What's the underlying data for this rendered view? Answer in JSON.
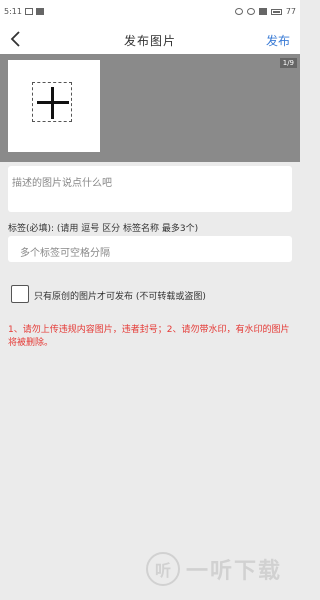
{
  "status_bar": {
    "time": "5:11",
    "battery": "77"
  },
  "navbar": {
    "title": "发布图片",
    "publish_label": "发布"
  },
  "photos": {
    "counter": "1/9"
  },
  "description": {
    "placeholder": "描述的图片说点什么吧"
  },
  "tags": {
    "label": "标签(必填): (请用 逗号 区分 标签名称 最多3个)",
    "placeholder": "多个标签可空格分隔"
  },
  "original": {
    "label": "只有原创的图片才可发布 (不可转载或盗图)",
    "checked": false
  },
  "notice": {
    "text": "1、请勿上传违规内容图片，违者封号；2、请勿带水印，有水印的图片将被删除。"
  },
  "watermark": {
    "logo_char": "听",
    "text": "一听下载"
  }
}
